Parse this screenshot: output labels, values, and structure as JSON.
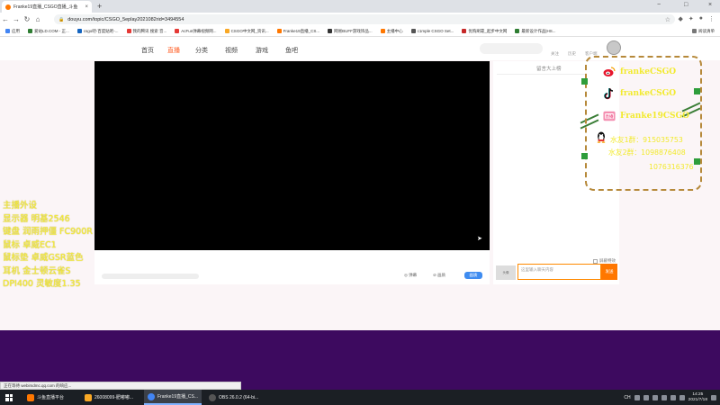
{
  "browser": {
    "tab_title": "Franke19直播_CSGO直播_斗鱼",
    "url": "douyu.com/topic/CSGO_5eplay2021082rid=3494554",
    "new_tab_symbol": "+",
    "window_controls": [
      "−",
      "□",
      "×"
    ]
  },
  "bookmarks": [
    {
      "label": "应用",
      "color": "#4285f4"
    },
    {
      "label": "爱站LD.COM - 正...",
      "color": "#2e7d32"
    },
    {
      "label": "csgo吧-百度贴吧-...",
      "color": "#1565c0"
    },
    {
      "label": "我的腾讯 搜索 音...",
      "color": "#e53935"
    },
    {
      "label": "AcFun弹幕视频网...",
      "color": "#e53935"
    },
    {
      "label": "CSGO中文网_资讯...",
      "color": "#f9a825"
    },
    {
      "label": "Franke19直播_CS...",
      "color": "#ff7700"
    },
    {
      "label": "网易BUFF游戏饰品...",
      "color": "#333333"
    },
    {
      "label": "主播中心",
      "color": "#ff7700"
    },
    {
      "label": "c1mple CSGO Set...",
      "color": "#555555"
    },
    {
      "label": "优购刷靠_起步中文网",
      "color": "#c62828"
    },
    {
      "label": "最新设计作品|HS...",
      "color": "#2e7d32"
    }
  ],
  "bookmarks_right": "阅读清单",
  "site_nav": [
    "首页",
    "直播",
    "分类",
    "视频",
    "游戏",
    "鱼吧"
  ],
  "site_nav_mini": [
    "关注",
    "历史",
    "客户端"
  ],
  "right_note": "留言大上榜",
  "controls": {
    "options": [
      "◎ 弹幕",
      "⊘ 画质"
    ],
    "button": "画质"
  },
  "chat": {
    "block_label": "屏蔽特效",
    "avatar_label": "头像",
    "placeholder": "这里输入聊天内容",
    "send": "发送"
  },
  "specs": [
    "主播外设",
    "显示器  明基2546",
    "键盘  润雨押僵 FC900R",
    "鼠标  卓威EC1",
    "鼠标垫  卓威GSR蓝色",
    "耳机  金士顿云雀S",
    "DPI400  灵敏度1.35"
  ],
  "social": {
    "weibo": "frankeCSGO",
    "douyin": "frankeCSGO",
    "bilibili": "Franke19CSGO",
    "qq_lines": [
      "水友1群：915035753",
      "水友2群：1098876408",
      "1076316376"
    ]
  },
  "status_url": "正在等待 webimdmc.qq.com 的响应...",
  "taskbar": {
    "tasks": [
      {
        "label": "斗鱼直播平台",
        "color": "#ff7700",
        "active": false
      },
      {
        "label": "26008099-肥嘟嘟...",
        "color": "#f9a825",
        "active": false
      },
      {
        "label": "Franke19直播_CS...",
        "color": "#4285f4",
        "active": true
      },
      {
        "label": "OBS 26.0.2 (64-bi...",
        "color": "#555555",
        "active": false
      }
    ],
    "tray_text": "CH",
    "time": "14:25",
    "date": "2021/7/18"
  },
  "colors": {
    "accent": "#ff5d23",
    "overlay_yellow": "#f7ef3a",
    "purple_band": "#3d0a5f"
  }
}
